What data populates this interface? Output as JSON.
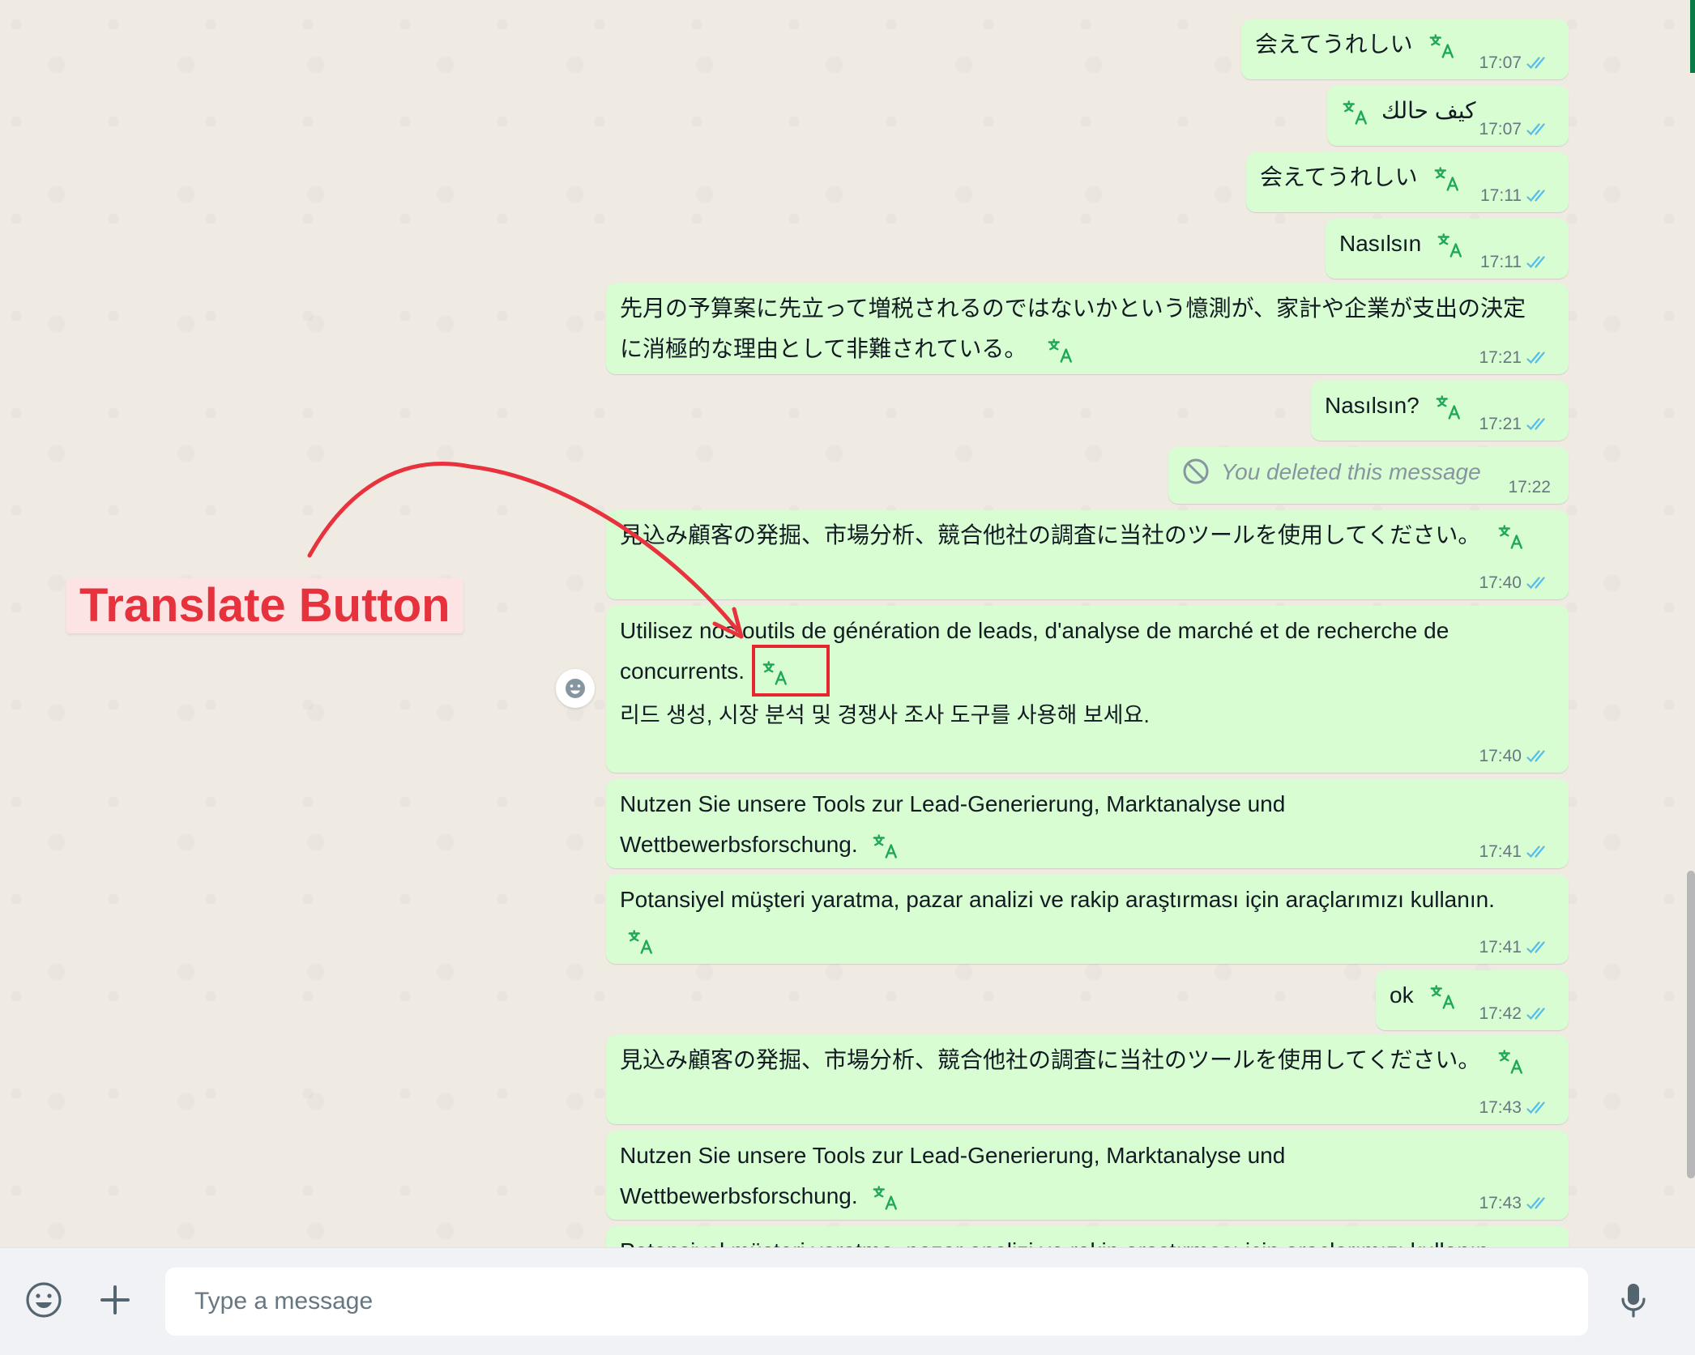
{
  "messages": [
    {
      "text": "会えてうれしい",
      "time": "17:07"
    },
    {
      "text": "كيف حالك",
      "time": "17:07"
    },
    {
      "text": "会えてうれしい",
      "time": "17:11"
    },
    {
      "text": "Nasılsın",
      "time": "17:11"
    },
    {
      "line1": "先月の予算案に先立って増税されるのではないかという憶測が、家計や企業が支出の決定",
      "line2": "に消極的な理由として非難されている。",
      "time": "17:21"
    },
    {
      "text": "Nasılsın?",
      "time": "17:21"
    },
    {
      "text": "You deleted this message",
      "time": "17:22"
    },
    {
      "text": "見込み顧客の発掘、市場分析、競合他社の調査に当社のツールを使用してください。",
      "time": "17:40"
    },
    {
      "line1": "Utilisez nos outils de génération de leads, d'analyse de marché et de recherche de",
      "line2": "concurrents.",
      "translation": "리드 생성, 시장 분석 및 경쟁사 조사 도구를 사용해 보세요.",
      "time": "17:40"
    },
    {
      "line1": "Nutzen Sie unsere Tools zur Lead-Generierung, Marktanalyse und",
      "line2": "Wettbewerbsforschung.",
      "time": "17:41"
    },
    {
      "line1": "Potansiyel müşteri yaratma, pazar analizi ve rakip araştırması için araçlarımızı kullanın.",
      "time": "17:41"
    },
    {
      "text": "ok",
      "time": "17:42"
    },
    {
      "text": "見込み顧客の発掘、市場分析、競合他社の調査に当社のツールを使用してください。",
      "time": "17:43"
    },
    {
      "line1": "Nutzen Sie unsere Tools zur Lead-Generierung, Marktanalyse und",
      "line2": "Wettbewerbsforschung.",
      "time": "17:43"
    },
    {
      "text": "Potansiyel müşteri yaratma, pazar analizi ve rakip araştırması için araçlarımızı kullanın."
    }
  ],
  "annotation": {
    "label": "Translate Button"
  },
  "composer": {
    "placeholder": "Type a message"
  },
  "icons": {
    "translate": "translate-icon",
    "ticks": "double-check-icon",
    "emoji": "emoji-icon",
    "attach": "plus-icon",
    "mic": "mic-icon",
    "deleted": "ban-icon"
  },
  "colors": {
    "bubble": "#d9fdd3",
    "translate_icon": "#1fa855",
    "ticks": "#53bdeb",
    "annotation": "#e3262f"
  }
}
